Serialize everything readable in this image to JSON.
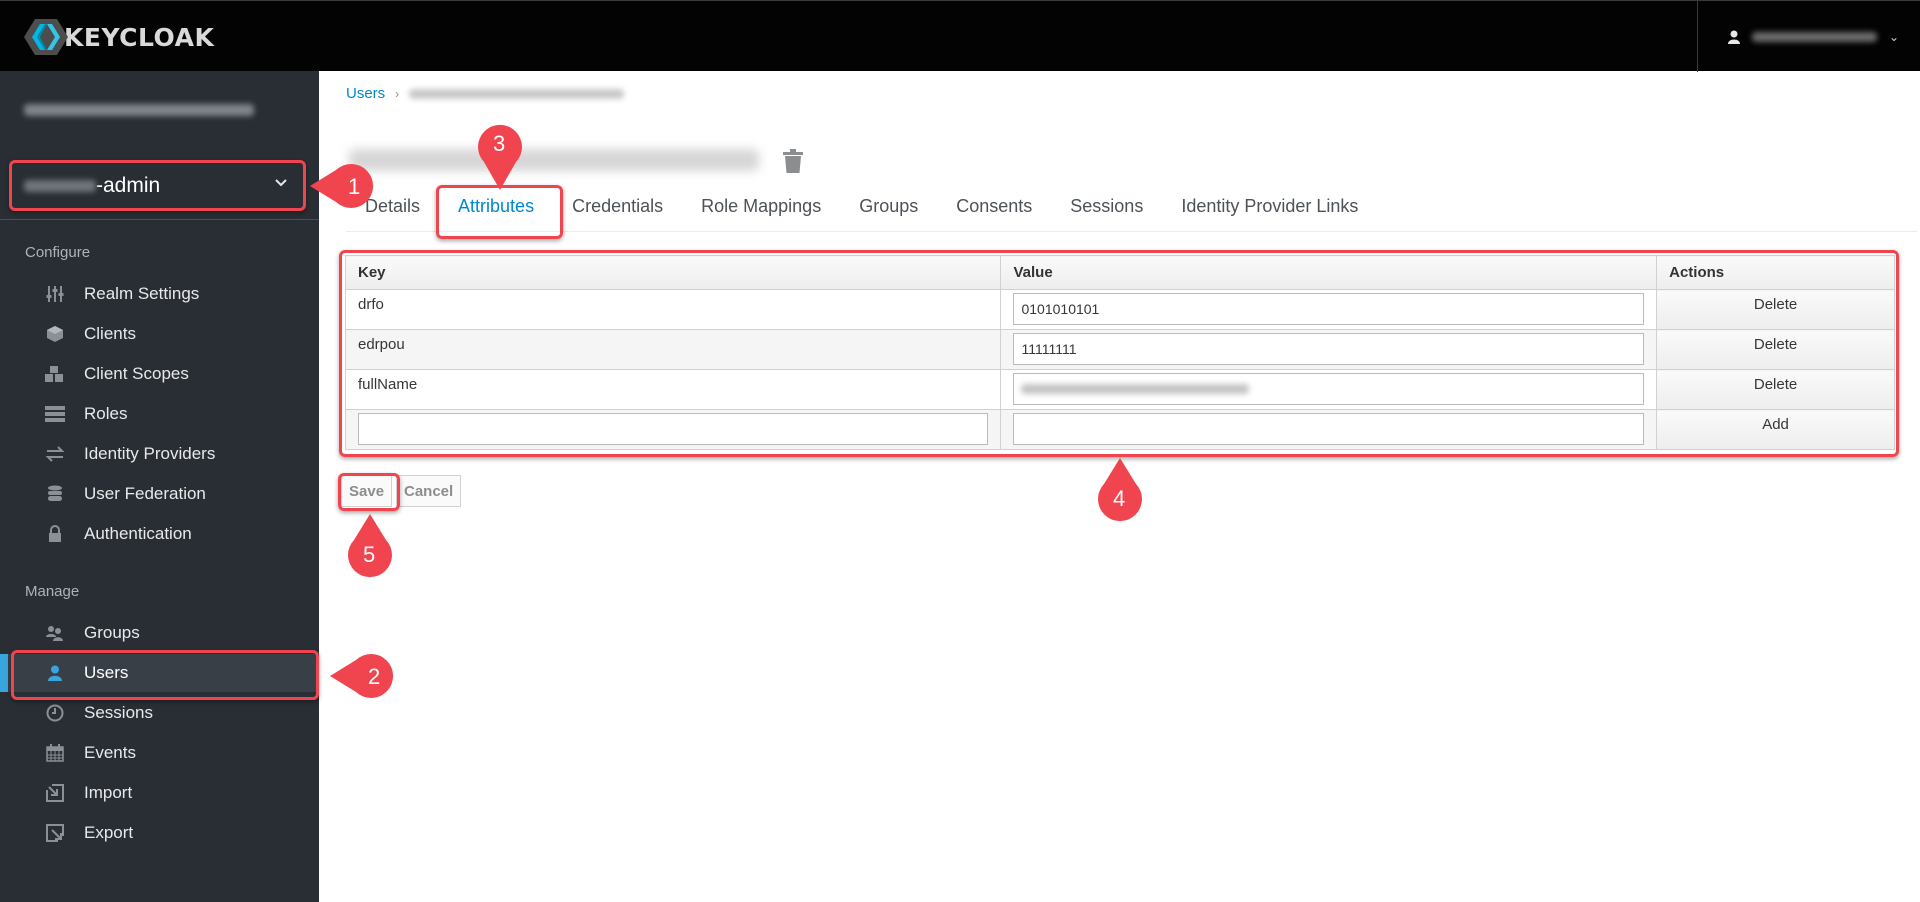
{
  "header": {
    "brand": "KEYCLOAK",
    "user_name": "[blurred user name]"
  },
  "sidebar": {
    "realm_name": "[blurred realm name]",
    "realm_selector": {
      "prefix_blurred": "[blurred]",
      "suffix": "-admin"
    },
    "configure_label": "Configure",
    "configure_items": [
      {
        "label": "Realm Settings",
        "icon": "sliders-icon"
      },
      {
        "label": "Clients",
        "icon": "cube-icon"
      },
      {
        "label": "Client Scopes",
        "icon": "cubes-icon"
      },
      {
        "label": "Roles",
        "icon": "server-icon"
      },
      {
        "label": "Identity Providers",
        "icon": "exchange-icon"
      },
      {
        "label": "User Federation",
        "icon": "database-icon"
      },
      {
        "label": "Authentication",
        "icon": "lock-icon"
      }
    ],
    "manage_label": "Manage",
    "manage_items": [
      {
        "label": "Groups",
        "icon": "users-icon"
      },
      {
        "label": "Users",
        "icon": "user-icon",
        "active": true
      },
      {
        "label": "Sessions",
        "icon": "clock-icon"
      },
      {
        "label": "Events",
        "icon": "calendar-icon"
      },
      {
        "label": "Import",
        "icon": "import-icon"
      },
      {
        "label": "Export",
        "icon": "export-icon"
      }
    ]
  },
  "main": {
    "breadcrumb": {
      "root": "Users",
      "current": "[blurred user email]"
    },
    "title": "[blurred user email]",
    "tabs": [
      {
        "label": "Details"
      },
      {
        "label": "Attributes",
        "active": true
      },
      {
        "label": "Credentials"
      },
      {
        "label": "Role Mappings"
      },
      {
        "label": "Groups"
      },
      {
        "label": "Consents"
      },
      {
        "label": "Sessions"
      },
      {
        "label": "Identity Provider Links"
      }
    ],
    "attributes_table": {
      "columns": [
        "Key",
        "Value",
        "Actions"
      ],
      "rows": [
        {
          "key": "drfo",
          "value": "0101010101",
          "action": "Delete"
        },
        {
          "key": "edrpou",
          "value": "11111111",
          "action": "Delete"
        },
        {
          "key": "fullName",
          "value": "[blurred full name]",
          "action": "Delete"
        }
      ],
      "new_row": {
        "key_placeholder": "",
        "value_placeholder": "",
        "action": "Add"
      }
    },
    "buttons": {
      "save": "Save",
      "cancel": "Cancel"
    }
  },
  "annotations": {
    "colors": {
      "callout": "#f0454f",
      "accent": "#0088ce",
      "active_nav": "#39a5dc"
    },
    "markers": [
      "1",
      "2",
      "3",
      "4",
      "5"
    ]
  }
}
